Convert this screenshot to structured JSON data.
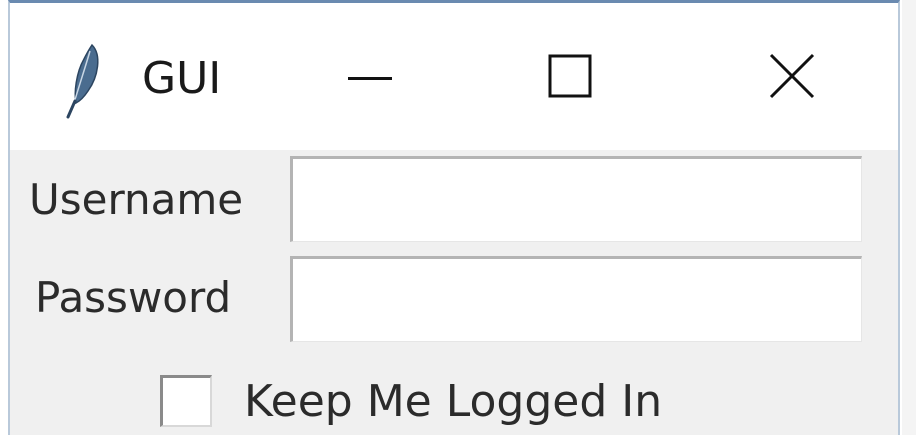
{
  "window": {
    "title": "GUI",
    "icon": "feather-icon",
    "controls": {
      "minimize_icon": "minimize-icon",
      "maximize_icon": "maximize-icon",
      "close_icon": "close-icon"
    }
  },
  "form": {
    "username_label": "Username",
    "username_value": "",
    "password_label": "Password",
    "password_value": "",
    "keep_logged_in_label": "Keep Me Logged In",
    "keep_logged_in_checked": false
  },
  "colors": {
    "window_border": "#6a8ab0",
    "titlebar_bg": "#ffffff",
    "content_bg": "#f0f0f0",
    "feather_icon": "#4a6c8f"
  }
}
